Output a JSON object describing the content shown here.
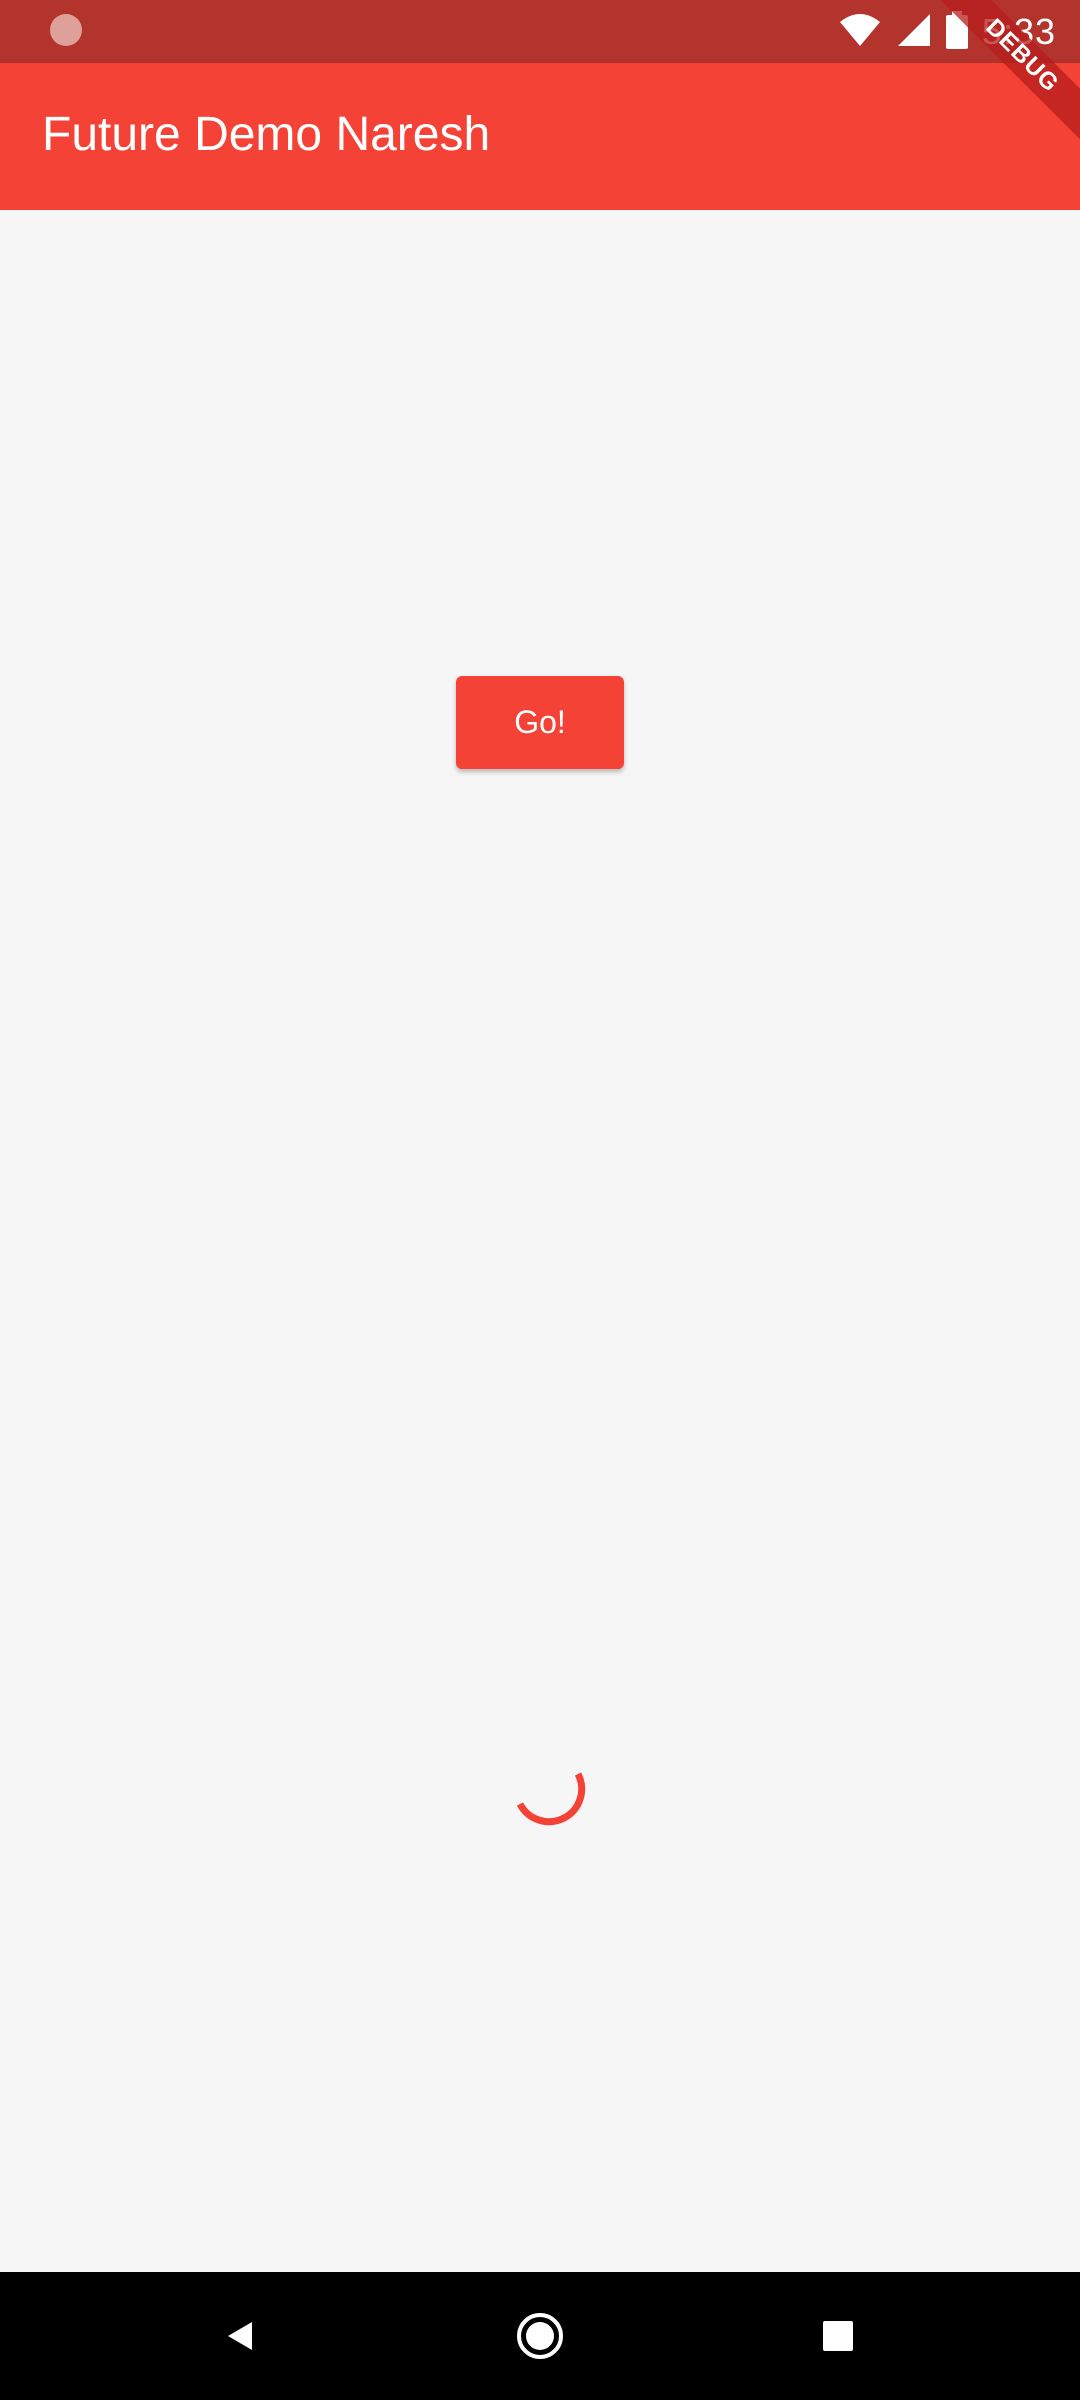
{
  "status_bar": {
    "time": "5:33",
    "icons": [
      "notification-dot-icon",
      "wifi-icon",
      "cell-signal-icon",
      "battery-icon"
    ]
  },
  "app_bar": {
    "title": "Future Demo Naresh",
    "color": "#f44336"
  },
  "debug_banner": {
    "label": "DEBUG"
  },
  "main": {
    "button_label": "Go!",
    "spinner_color": "#f44336"
  },
  "nav_bar": {
    "buttons": [
      "back-icon",
      "home-icon",
      "recents-icon"
    ]
  },
  "colors": {
    "status_bar": "#b2342c",
    "accent": "#f44336",
    "background": "#f7f6f7",
    "nav_bar": "#000000"
  }
}
